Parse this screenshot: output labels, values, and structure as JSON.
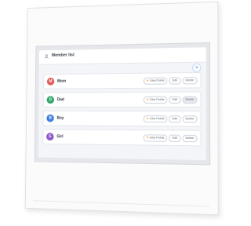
{
  "header": {
    "title": "Member list"
  },
  "add_button": {
    "label": "+"
  },
  "colors": {
    "accent": "#3b7de0"
  },
  "members": [
    {
      "initial": "M",
      "name": "Mom",
      "color": "#e25b5b",
      "actions": [
        "Give Points",
        "Edit",
        "Delete"
      ]
    },
    {
      "initial": "D",
      "name": "Dad",
      "color": "#2ea56b",
      "actions": [
        "Give Points",
        "Edit",
        "Delete"
      ]
    },
    {
      "initial": "B",
      "name": "Boy",
      "color": "#3b7de0",
      "actions": [
        "Give Points",
        "Edit",
        "Delete"
      ]
    },
    {
      "initial": "G",
      "name": "Girl",
      "color": "#8a57c8",
      "actions": [
        "Give Points",
        "Edit",
        "Delete"
      ]
    }
  ]
}
